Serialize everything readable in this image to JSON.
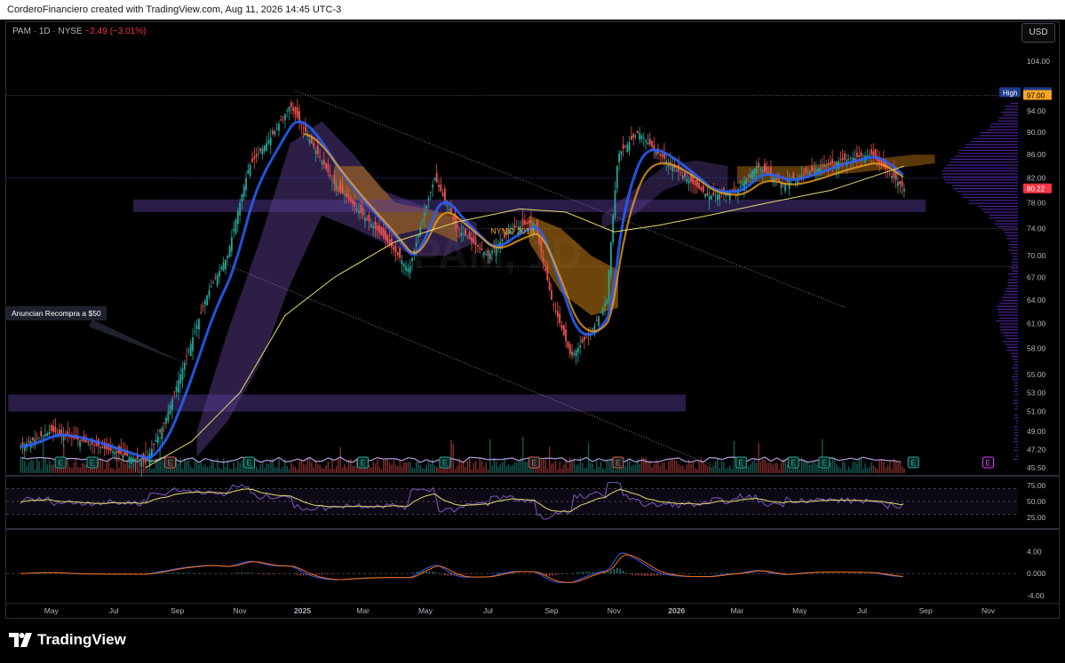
{
  "header": {
    "caption": "CorderoFinanciero created with TradingView.com, Aug 11, 2026 14:45 UTC-3"
  },
  "symbol": {
    "name": "PAM · 1D · NYSE",
    "change": "−2.49 (−3.01%)"
  },
  "currency_button": "USD",
  "callout": "Anuncian Recompra a $50",
  "annotation": "NYMO 2018",
  "watermark": "PAM, 1D",
  "logo_text": "TradingView",
  "colors": {
    "up": "#26a69a",
    "down": "#ef5350",
    "ema_fast": "#2962ff",
    "sma_slow": "#e6d96b",
    "ribbon": "#f5a623",
    "cloud_purple": "#7e57c2",
    "cloud_orange": "#c77d16",
    "zone": "#5b3f9e",
    "rsi": "#7e57c2",
    "macd": "#2962ff",
    "signal": "#ff6d00"
  },
  "chart_data": {
    "type": "candlestick",
    "title": "",
    "x_ticks": [
      "May",
      "Jul",
      "Sep",
      "Nov",
      "2025",
      "Mar",
      "May",
      "Jul",
      "Sep",
      "Nov",
      "2026",
      "Mar",
      "May",
      "Jul",
      "Sep",
      "Nov"
    ],
    "y_ticks": [
      104.0,
      94.0,
      90.0,
      86.0,
      82.0,
      78.0,
      74.0,
      70.0,
      67.0,
      64.0,
      61.0,
      58.0,
      55.0,
      53.0,
      51.0,
      49.0,
      47.2,
      45.5
    ],
    "ylim": [
      45,
      108
    ],
    "scale": "log",
    "last_price": 80.22,
    "high_label": {
      "text": "High",
      "value": 97.55
    },
    "level_label": 97.0,
    "close_series": [
      [
        "2024-04-01",
        47.5
      ],
      [
        "2024-05-01",
        49.0
      ],
      [
        "2024-06-01",
        48.0
      ],
      [
        "2024-07-01",
        47.0
      ],
      [
        "2024-08-01",
        46.0
      ],
      [
        "2024-08-20",
        50.0
      ],
      [
        "2024-09-10",
        57.0
      ],
      [
        "2024-10-01",
        65.0
      ],
      [
        "2024-10-20",
        70.0
      ],
      [
        "2024-11-10",
        84.0
      ],
      [
        "2024-12-01",
        89.0
      ],
      [
        "2024-12-20",
        95.0
      ],
      [
        "2025-01-10",
        88.0
      ],
      [
        "2025-02-01",
        81.0
      ],
      [
        "2025-03-01",
        76.0
      ],
      [
        "2025-03-25",
        72.0
      ],
      [
        "2025-04-15",
        68.0
      ],
      [
        "2025-05-10",
        82.0
      ],
      [
        "2025-06-01",
        74.0
      ],
      [
        "2025-07-01",
        70.0
      ],
      [
        "2025-07-25",
        74.0
      ],
      [
        "2025-08-15",
        75.0
      ],
      [
        "2025-09-01",
        64.0
      ],
      [
        "2025-09-20",
        57.0
      ],
      [
        "2025-10-10",
        60.0
      ],
      [
        "2025-10-25",
        64.0
      ],
      [
        "2025-11-05",
        86.0
      ],
      [
        "2025-11-25",
        90.0
      ],
      [
        "2025-12-15",
        86.0
      ],
      [
        "2026-01-10",
        82.0
      ],
      [
        "2026-02-01",
        79.0
      ],
      [
        "2026-03-01",
        80.0
      ],
      [
        "2026-03-20",
        84.0
      ],
      [
        "2026-04-15",
        81.0
      ],
      [
        "2026-05-10",
        83.0
      ],
      [
        "2026-06-10",
        85.0
      ],
      [
        "2026-07-10",
        86.0
      ],
      [
        "2026-08-11",
        80.22
      ]
    ],
    "sma_slow": [
      [
        "2024-08-01",
        45.5
      ],
      [
        "2024-09-15",
        48.0
      ],
      [
        "2024-11-01",
        53.0
      ],
      [
        "2024-12-15",
        62.0
      ],
      [
        "2025-02-01",
        67.0
      ],
      [
        "2025-04-01",
        72.0
      ],
      [
        "2025-06-01",
        75.0
      ],
      [
        "2025-08-01",
        77.0
      ],
      [
        "2025-09-15",
        76.5
      ],
      [
        "2025-11-01",
        73.5
      ],
      [
        "2025-12-15",
        74.5
      ],
      [
        "2026-02-01",
        76.0
      ],
      [
        "2026-04-01",
        78.0
      ],
      [
        "2026-06-01",
        80.0
      ],
      [
        "2026-08-11",
        84.0
      ]
    ],
    "horizontal_zones": [
      {
        "name": "zone-upper",
        "from_date": "2024-07-20",
        "to_date": "2026-09-01",
        "low": 76.5,
        "high": 78.5
      },
      {
        "name": "zone-lower",
        "from_date": "2024-03-20",
        "to_date": "2026-01-10",
        "low": 51.0,
        "high": 52.8
      }
    ],
    "trendlines": [
      {
        "name": "upper-channel",
        "from": [
          "2024-12-25",
          98.0
        ],
        "to": [
          "2026-06-15",
          63.0
        ]
      },
      {
        "name": "lower-channel",
        "from": [
          "2024-10-15",
          69.0
        ],
        "to": [
          "2026-02-10",
          45.5
        ]
      }
    ],
    "earnings_markers": [
      {
        "date": "2024-05-10",
        "label": "E",
        "kind": "up"
      },
      {
        "date": "2024-06-10",
        "label": "E",
        "kind": "up"
      },
      {
        "date": "2024-08-25",
        "label": "E",
        "kind": "down"
      },
      {
        "date": "2024-11-10",
        "label": "E",
        "kind": "up"
      },
      {
        "date": "2025-03-01",
        "label": "E",
        "kind": "up"
      },
      {
        "date": "2025-05-20",
        "label": "E",
        "kind": "up"
      },
      {
        "date": "2025-08-15",
        "label": "E",
        "kind": "down"
      },
      {
        "date": "2025-11-05",
        "label": "E",
        "kind": "down"
      },
      {
        "date": "2026-03-05",
        "label": "E",
        "kind": "up"
      },
      {
        "date": "2026-04-25",
        "label": "E",
        "kind": "up"
      },
      {
        "date": "2026-05-25",
        "label": "E",
        "kind": "up"
      },
      {
        "date": "2026-08-20",
        "label": "E",
        "kind": "up"
      },
      {
        "date": "2026-11-01",
        "label": "E",
        "kind": "future"
      }
    ],
    "rsi": {
      "y_ticks": [
        75.0,
        50.0,
        25.0
      ],
      "ylim": [
        15,
        85
      ],
      "band": [
        30,
        70
      ]
    },
    "macd": {
      "y_ticks": [
        4.0,
        0.0,
        -4.0
      ],
      "ylim": [
        -5.5,
        7.0
      ],
      "zero_label": "0.000"
    }
  }
}
